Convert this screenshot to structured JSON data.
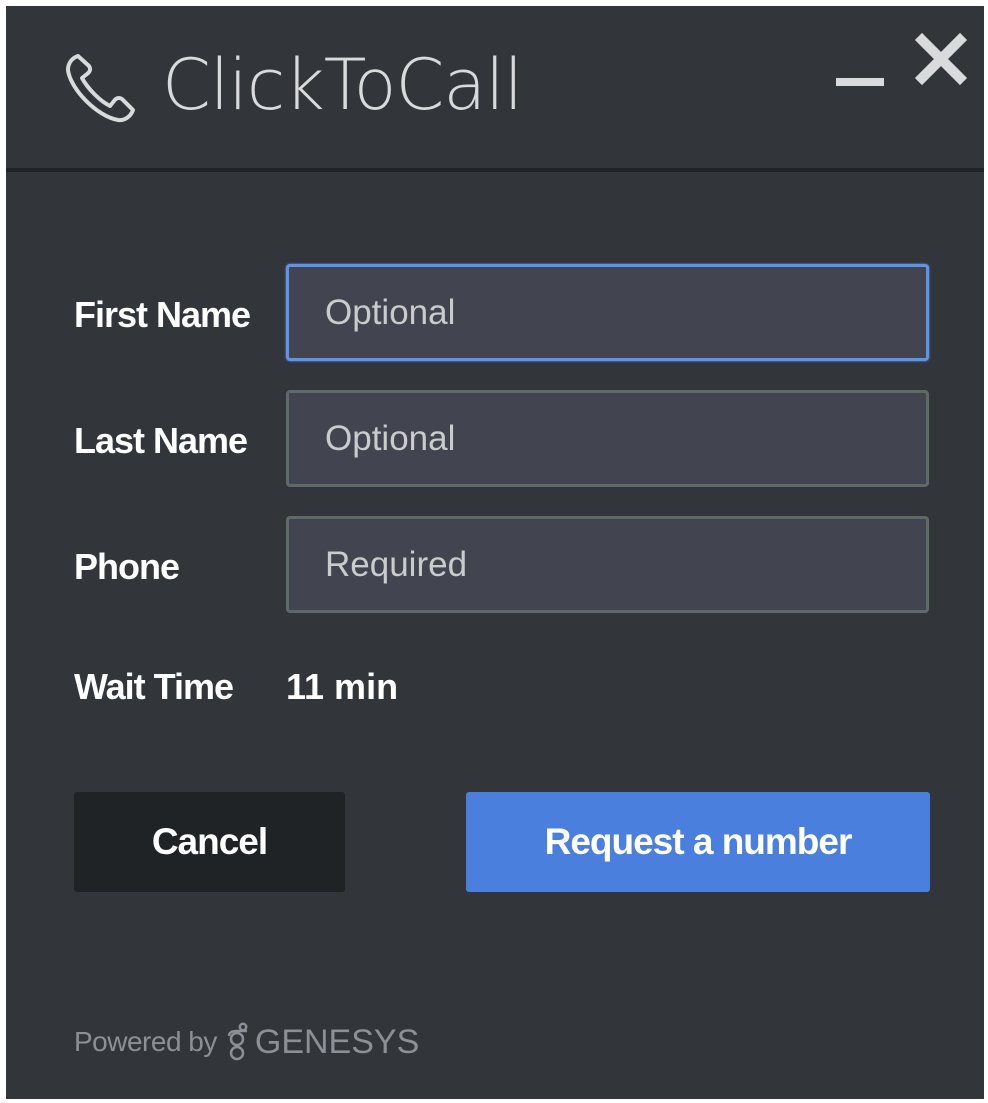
{
  "header": {
    "title": "ClickToCall",
    "icon": "phone-icon",
    "minimize_icon": "minimize-icon",
    "close_icon": "close-icon"
  },
  "form": {
    "fields": [
      {
        "label": "First Name",
        "placeholder": "Optional",
        "value": ""
      },
      {
        "label": "Last Name",
        "placeholder": "Optional",
        "value": ""
      },
      {
        "label": "Phone",
        "placeholder": "Required",
        "value": ""
      }
    ],
    "wait_time": {
      "label": "Wait Time",
      "value": "11 min"
    }
  },
  "actions": {
    "cancel_label": "Cancel",
    "request_label": "Request a number"
  },
  "footer": {
    "powered_by": "Powered by",
    "brand": "GENESYS"
  },
  "colors": {
    "background": "#32363b",
    "accent": "#4a7fdd",
    "field_background": "#42454f",
    "cancel_background": "#202326"
  }
}
